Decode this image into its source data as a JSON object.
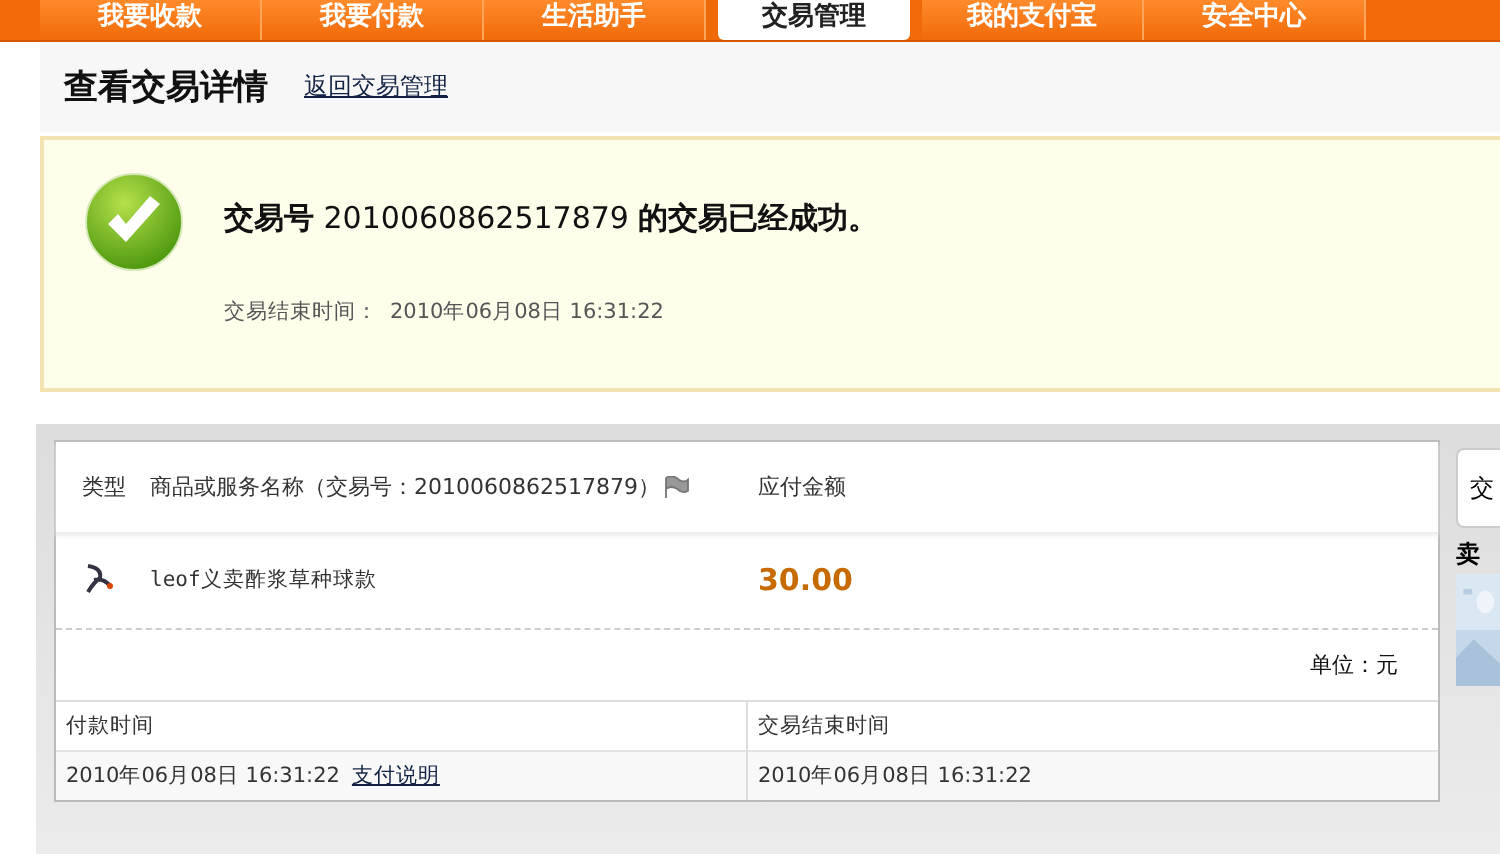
{
  "nav_tabs": [
    {
      "label": "我要收款",
      "selected": false
    },
    {
      "label": "我要付款",
      "selected": false
    },
    {
      "label": "生活助手",
      "selected": false
    },
    {
      "label": "交易管理",
      "selected": true
    },
    {
      "label": "我的支付宝",
      "selected": false
    },
    {
      "label": "安全中心",
      "selected": false
    }
  ],
  "header": {
    "title": "查看交易详情",
    "back_link": "返回交易管理"
  },
  "success": {
    "message": "**交易号** 2010060862517879 **的交易已经成功。**",
    "end_time_label": "交易结束时间：",
    "end_time": "2010年06月08日 16:31:22"
  },
  "order": {
    "columns": [
      "类型",
      "商品或服务名称（交易号：2010060862517879）",
      "应付金额"
    ],
    "item": {
      "name": "leof义卖酢浆草种球款",
      "amount": "30.00"
    },
    "unit": "单位：元",
    "times": [
      {
        "label": "付款时间",
        "value": "2010年06月08日 16:31:22",
        "link": "支付说明"
      },
      {
        "label": "交易结束时间",
        "value": "2010年06月08日 16:31:22"
      }
    ]
  },
  "side_panel": {
    "tab": "交",
    "heading": "卖"
  }
}
